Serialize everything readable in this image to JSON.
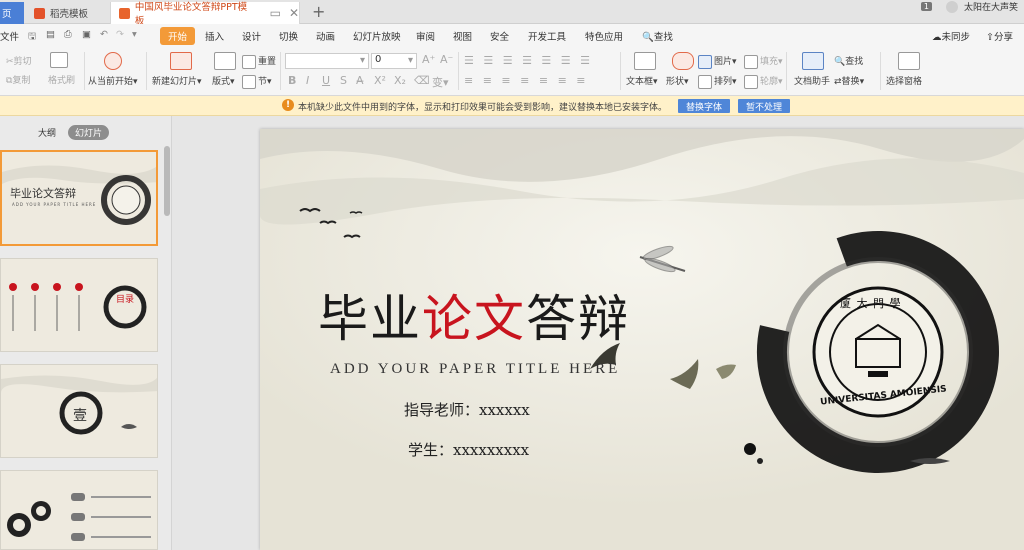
{
  "tabs": {
    "blue_fragment": "页",
    "docer": "稻壳模板",
    "doc": "中国风毕业论文答辩PPT模板",
    "page_count": "1",
    "user_name": "太阳在大声笑"
  },
  "menu": {
    "file": "文件",
    "items": [
      "开始",
      "插入",
      "设计",
      "切换",
      "动画",
      "幻灯片放映",
      "审阅",
      "视图",
      "安全",
      "开发工具",
      "特色应用"
    ],
    "search": "查找",
    "sync": "未同步",
    "share": "分享"
  },
  "ribbon": {
    "cut": "剪切",
    "copy": "复制",
    "format_painter": "格式刷",
    "from_current": "从当前开始",
    "new_slide": "新建幻灯片",
    "layout": "版式",
    "reset": "重置",
    "section": "节",
    "font_size": "0",
    "textbox": "文本框",
    "shape": "形状",
    "picture": "图片",
    "fill": "填充",
    "arrange": "排列",
    "outline": "轮廓",
    "find": "查找",
    "replace": "替换",
    "doc_assistant": "文档助手",
    "select_pane": "选择窗格"
  },
  "notice": {
    "text": "本机缺少此文件中用到的字体，显示和打印效果可能会受到影响，建议替换本地已安装字体。",
    "replace_btn": "替换字体",
    "ignore_btn": "暂不处理"
  },
  "left_panel": {
    "outline_tab": "大纲",
    "slides_tab": "幻灯片",
    "thumb1_title": "毕业论文答辩",
    "thumb1_sub": "ADD YOUR PAPER TITLE HERE",
    "thumb2_label": "目录",
    "thumb3_label": "壹"
  },
  "slide": {
    "title_a": "毕业",
    "title_b": "论文",
    "title_c": "答辩",
    "subtitle": "ADD YOUR PAPER TITLE HERE",
    "advisor": "指导老师：xxxxxx",
    "student": "学生：xxxxxxxxx",
    "seal_top": "厦 大 門 學",
    "seal_ring": "UNIVERSITAS AMOIENSIS"
  },
  "colors": {
    "accent": "#f39a38",
    "title_red": "#c8141e",
    "notice_bg": "#fff1c9",
    "button_blue": "#4f86d8"
  }
}
